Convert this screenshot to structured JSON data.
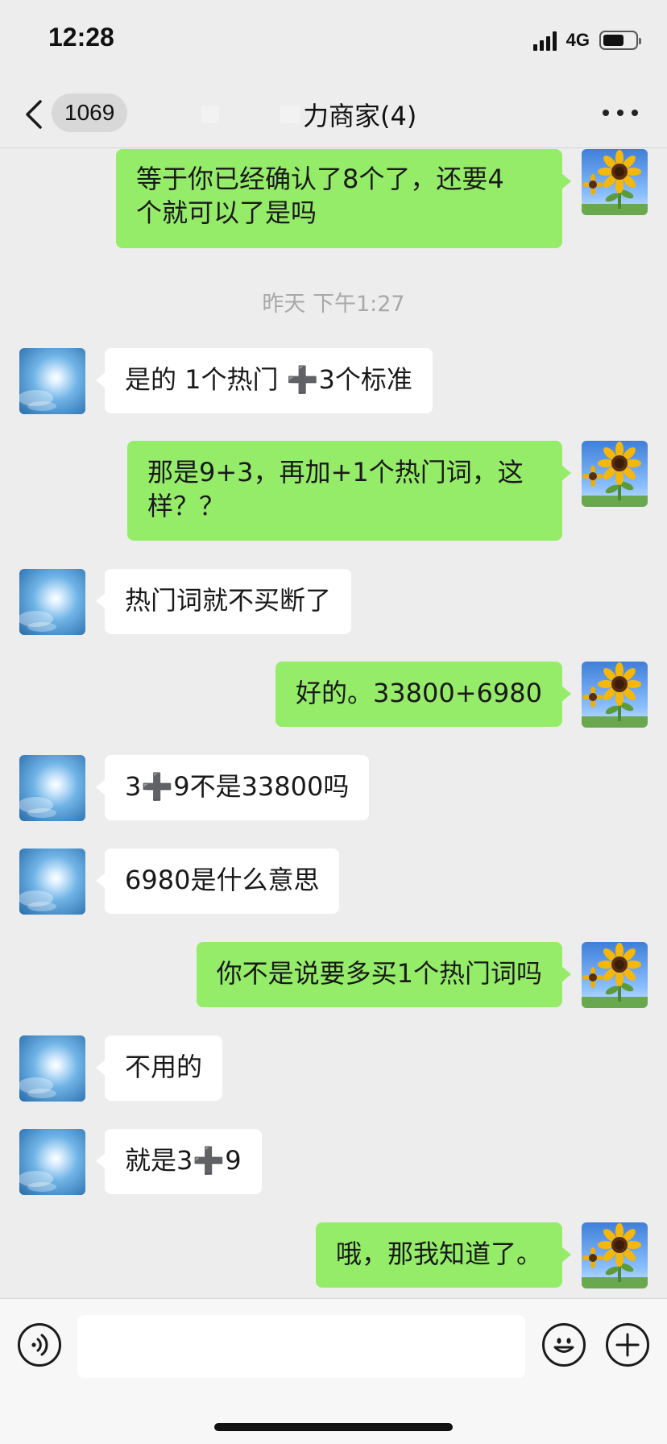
{
  "status_bar": {
    "time": "12:28",
    "network": "4G"
  },
  "nav": {
    "back_label": "<",
    "unread_count": "1069",
    "title": "力商家(4)",
    "more_label": "..."
  },
  "messages": [
    {
      "side": "out",
      "text": "等于你已经确认了8个了，还要4\n个就可以了是吗"
    },
    {
      "side": "time",
      "text": "昨天 下午1:27"
    },
    {
      "side": "in",
      "text": "是的 1个热门 ➕3个标准"
    },
    {
      "side": "out",
      "text": "那是9+3，再加+1个热门词，这\n样？？"
    },
    {
      "side": "in",
      "text": "热门词就不买断了"
    },
    {
      "side": "out",
      "text": "好的。33800+6980"
    },
    {
      "side": "in",
      "text": "3➕9不是33800吗"
    },
    {
      "side": "in",
      "text": "6980是什么意思"
    },
    {
      "side": "out",
      "text": "你不是说要多买1个热门词吗"
    },
    {
      "side": "in",
      "text": "不用的"
    },
    {
      "side": "in",
      "text": "就是3➕9"
    },
    {
      "side": "out",
      "text": "哦，那我知道了。"
    }
  ],
  "input_bar": {
    "voice_icon": "voice-icon",
    "emoji_icon": "emoji-icon",
    "plus_icon": "plus-icon",
    "input_value": ""
  },
  "colors": {
    "background": "#ededed",
    "outgoing_bubble": "#95ec69",
    "incoming_bubble": "#ffffff",
    "timestamp_text": "#a8a8a8"
  }
}
